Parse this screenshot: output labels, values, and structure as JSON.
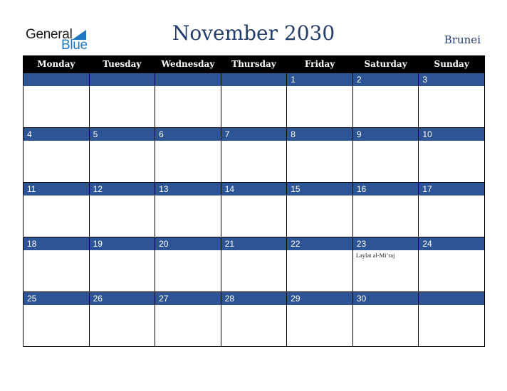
{
  "logo": {
    "word1": "General",
    "word2": "Blue"
  },
  "title": "November 2030",
  "country": "Brunei",
  "colors": {
    "header_bg": "#000000",
    "day_bar": "#2d5595",
    "title": "#233d6b",
    "logo_blue": "#1f78c1"
  },
  "weekdays": [
    "Monday",
    "Tuesday",
    "Wednesday",
    "Thursday",
    "Friday",
    "Saturday",
    "Sunday"
  ],
  "weeks": [
    [
      {
        "day": ""
      },
      {
        "day": ""
      },
      {
        "day": ""
      },
      {
        "day": ""
      },
      {
        "day": "1"
      },
      {
        "day": "2"
      },
      {
        "day": "3"
      }
    ],
    [
      {
        "day": "4"
      },
      {
        "day": "5"
      },
      {
        "day": "6"
      },
      {
        "day": "7"
      },
      {
        "day": "8"
      },
      {
        "day": "9"
      },
      {
        "day": "10"
      }
    ],
    [
      {
        "day": "11"
      },
      {
        "day": "12"
      },
      {
        "day": "13"
      },
      {
        "day": "14"
      },
      {
        "day": "15"
      },
      {
        "day": "16"
      },
      {
        "day": "17"
      }
    ],
    [
      {
        "day": "18"
      },
      {
        "day": "19"
      },
      {
        "day": "20"
      },
      {
        "day": "21"
      },
      {
        "day": "22"
      },
      {
        "day": "23",
        "event": "Laylat al-Mi’raj"
      },
      {
        "day": "24"
      }
    ],
    [
      {
        "day": "25"
      },
      {
        "day": "26"
      },
      {
        "day": "27"
      },
      {
        "day": "28"
      },
      {
        "day": "29"
      },
      {
        "day": "30"
      },
      {
        "day": ""
      }
    ]
  ]
}
